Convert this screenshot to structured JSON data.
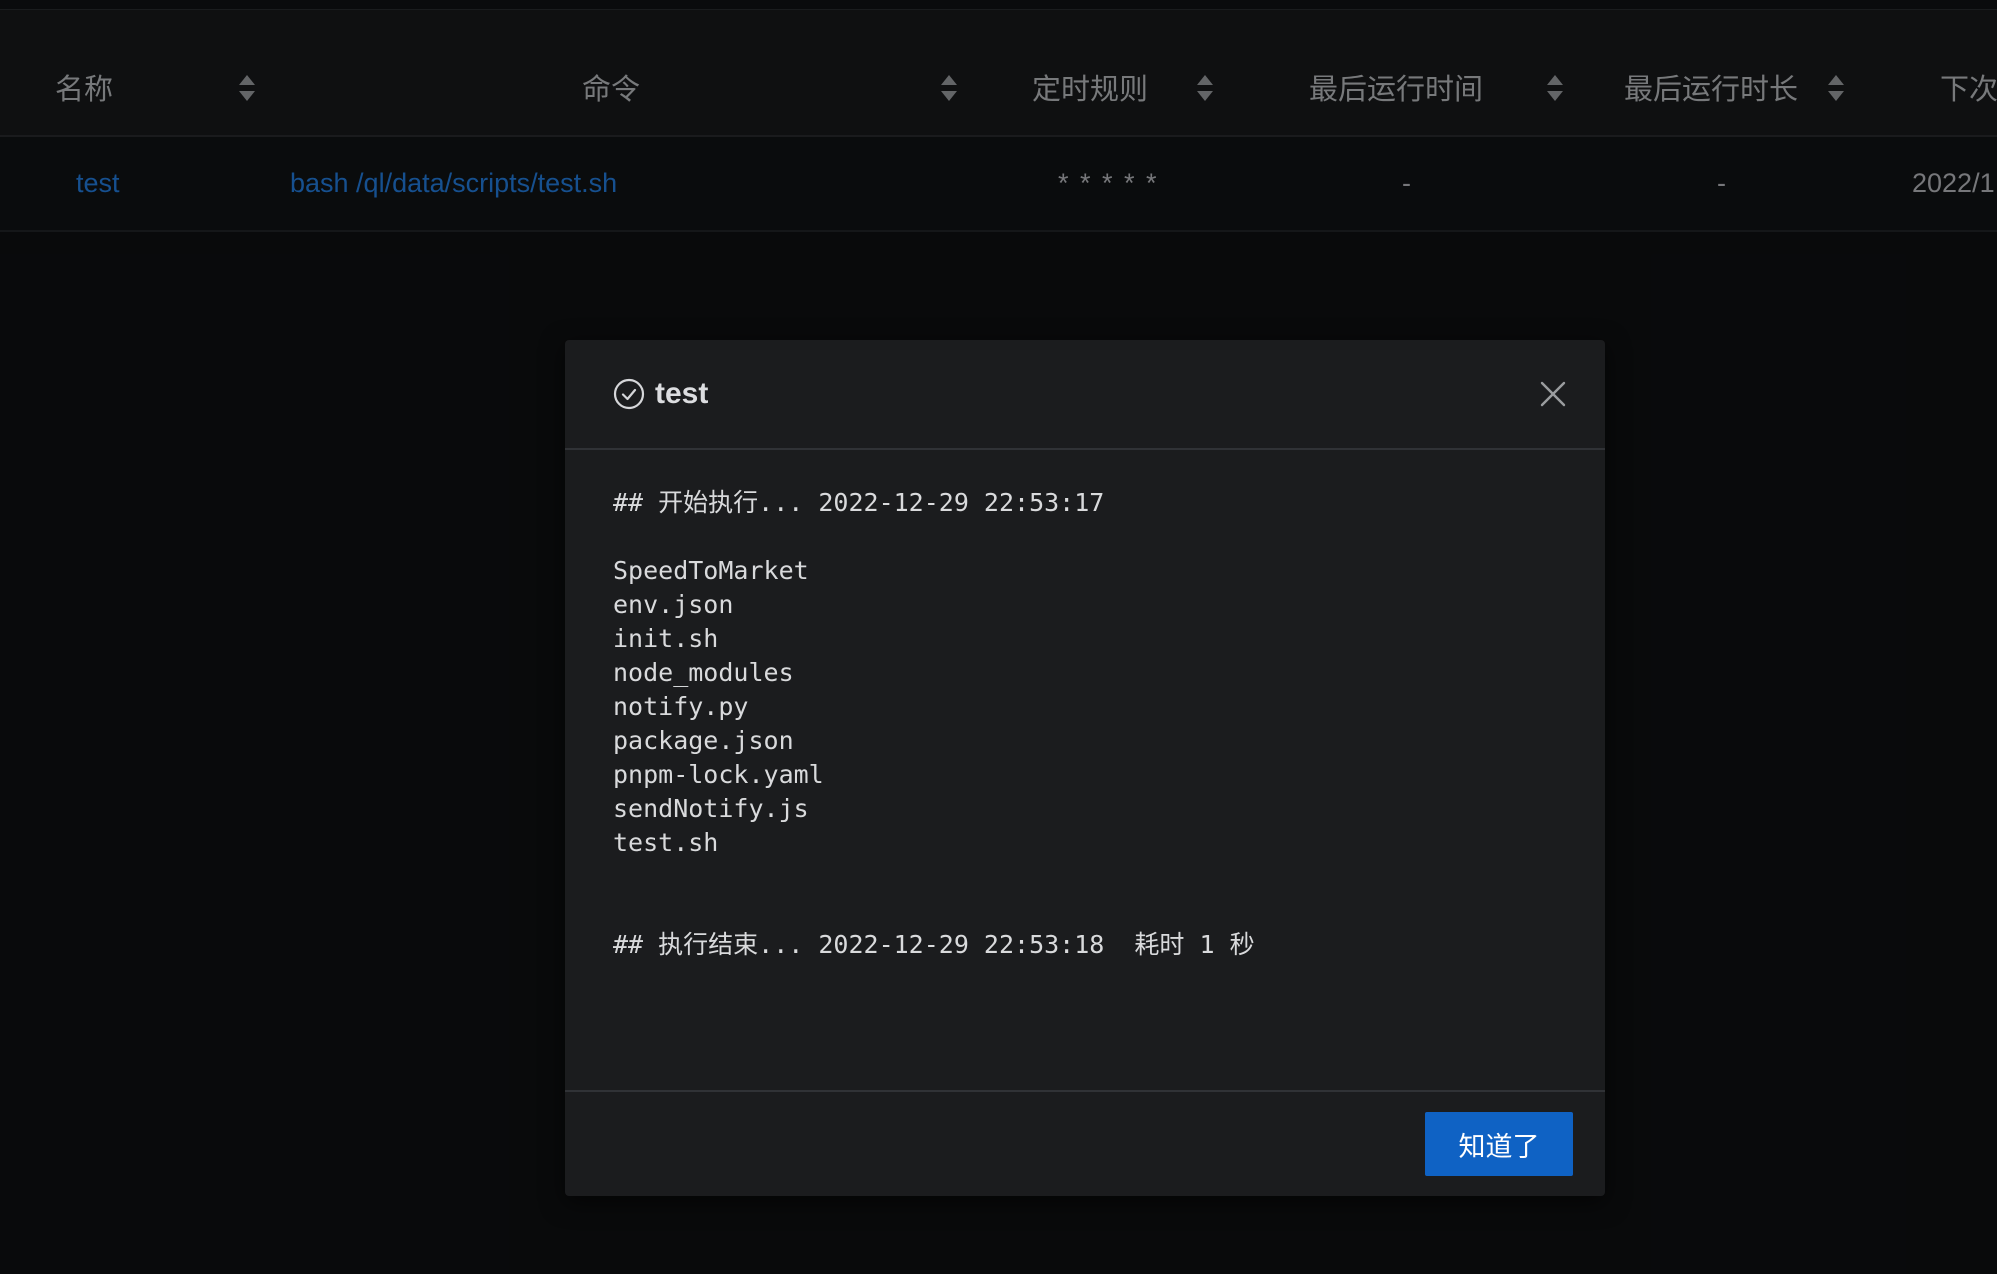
{
  "table": {
    "columns": [
      {
        "label": "名称",
        "sortable": true
      },
      {
        "label": "命令",
        "sortable": true
      },
      {
        "label": "定时规则",
        "sortable": true
      },
      {
        "label": "最后运行时间",
        "sortable": true
      },
      {
        "label": "最后运行时长",
        "sortable": true
      },
      {
        "label": "下次",
        "sortable": false
      }
    ],
    "rows": [
      {
        "name": "test",
        "command": "bash /ql/data/scripts/test.sh",
        "schedule": "* * * * *",
        "last_run_time": "-",
        "last_run_duration": "-",
        "next_run": "2022/1"
      }
    ]
  },
  "modal": {
    "title": "test",
    "status_icon": "check-circle-icon",
    "close_icon": "close-icon",
    "log": "## 开始执行... 2022-12-29 22:53:17\n\nSpeedToMarket\nenv.json\ninit.sh\nnode_modules\nnotify.py\npackage.json\npnpm-lock.yaml\nsendNotify.js\ntest.sh\n\n\n## 执行结束... 2022-12-29 22:53:18  耗时 1 秒",
    "ok_label": "知道了"
  },
  "colors": {
    "background": "#0d0e10",
    "header_bg": "#151718",
    "modal_bg": "#1b1c1e",
    "link": "#1f6fc7",
    "primary": "#0f62c4"
  }
}
